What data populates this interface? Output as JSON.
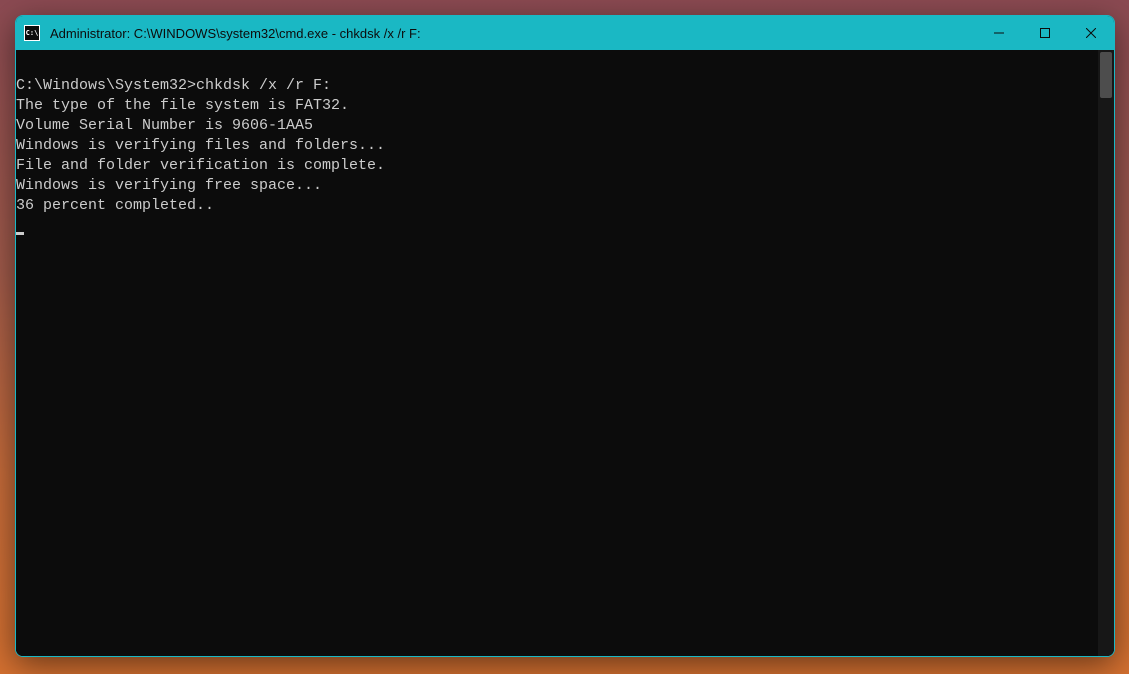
{
  "titlebar": {
    "icon_label": "C:\\",
    "title": "Administrator: C:\\WINDOWS\\system32\\cmd.exe - chkdsk  /x /r F:"
  },
  "terminal": {
    "prompt": "C:\\Windows\\System32>",
    "command": "chkdsk /x /r F:",
    "lines": [
      "The type of the file system is FAT32.",
      "Volume Serial Number is 9606-1AA5",
      "Windows is verifying files and folders...",
      "File and folder verification is complete.",
      "Windows is verifying free space...",
      "36 percent completed.."
    ]
  }
}
